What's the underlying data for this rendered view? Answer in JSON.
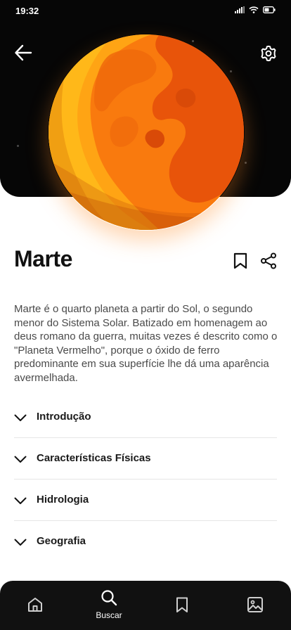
{
  "status_bar": {
    "time": "19:32",
    "icons": [
      "signal-icon",
      "wifi-icon",
      "battery-icon"
    ]
  },
  "header": {
    "back_icon": "arrow-left-icon",
    "settings_icon": "gear-icon"
  },
  "planet": {
    "image": "mars-illustration",
    "colors": {
      "base": "#F97A0E",
      "light": "#FFB216",
      "dark": "#E25A09"
    }
  },
  "article": {
    "title": "Marte",
    "bookmark_icon": "bookmark-icon",
    "share_icon": "share-icon",
    "description": "Marte é o quarto planeta a partir do Sol, o segundo menor do Sistema Solar. Batizado em homenagem ao deus romano da guerra, muitas vezes é descrito como o \"Planeta Vermelho\", porque o óxido de ferro predominante em sua superfície lhe dá uma aparência avermelhada."
  },
  "sections": [
    {
      "label": "Introdução"
    },
    {
      "label": "Características Físicas"
    },
    {
      "label": "Hidrologia"
    },
    {
      "label": "Geografia"
    }
  ],
  "bottom_nav": {
    "items": [
      {
        "icon": "home-icon",
        "label": ""
      },
      {
        "icon": "search-icon",
        "label": "Buscar",
        "active": true
      },
      {
        "icon": "bookmark-icon",
        "label": ""
      },
      {
        "icon": "image-icon",
        "label": ""
      }
    ]
  },
  "colors": {
    "hero_background": "#060606",
    "nav_background": "#111111",
    "text_primary": "#111111",
    "text_body": "#4A4A4A"
  }
}
